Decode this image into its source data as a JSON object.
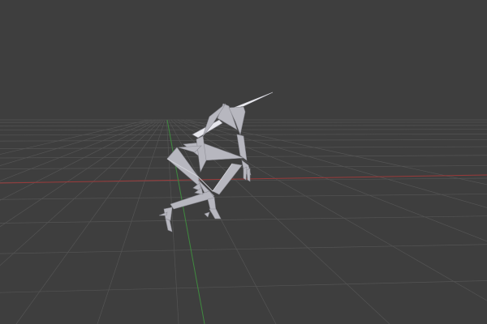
{
  "viewport": {
    "background_color": "#3e3e3e",
    "grid_color": "#545454",
    "x_axis_color": "#a33b3b",
    "y_axis_color": "#3f8f3f",
    "armature_color": "#b9b9c1",
    "armature_edge_color": "#d8d8de",
    "selected_bone_color": "#ececf2"
  }
}
